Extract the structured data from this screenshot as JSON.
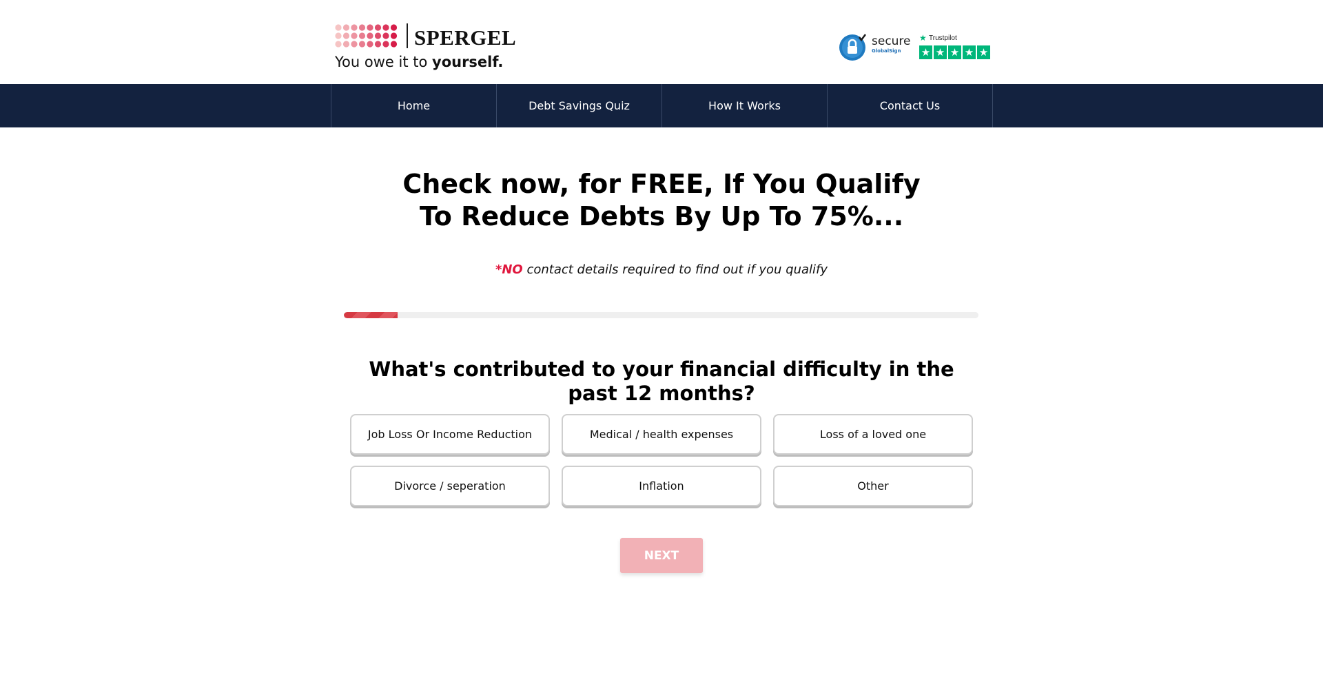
{
  "brand": {
    "name": "SPERGEL",
    "tagline_prefix": "You owe it to ",
    "tagline_bold": "yourself.",
    "accent": "#e0173d"
  },
  "badges": {
    "secure_word": "secure",
    "secure_sub": "GlobalSign",
    "trustpilot_label": "Trustpilot"
  },
  "nav": {
    "items": [
      "Home",
      "Debt Savings Quiz",
      "How It Works",
      "Contact Us"
    ],
    "background": "#13223f"
  },
  "hero": {
    "headline": "Check now, for FREE, If You Qualify To Reduce Debts By Up To 75%...",
    "note_prefix": "*NO",
    "note_rest": " contact details required to find out if you qualify"
  },
  "quiz": {
    "progress_fraction": 0.085,
    "question": "What's contributed to your financial difficulty in the past 12 months?",
    "options": [
      "Job Loss Or Income Reduction",
      "Medical / health expenses",
      "Loss of a loved one",
      "Divorce / seperation",
      "Inflation",
      "Other"
    ],
    "next_label": "NEXT"
  }
}
